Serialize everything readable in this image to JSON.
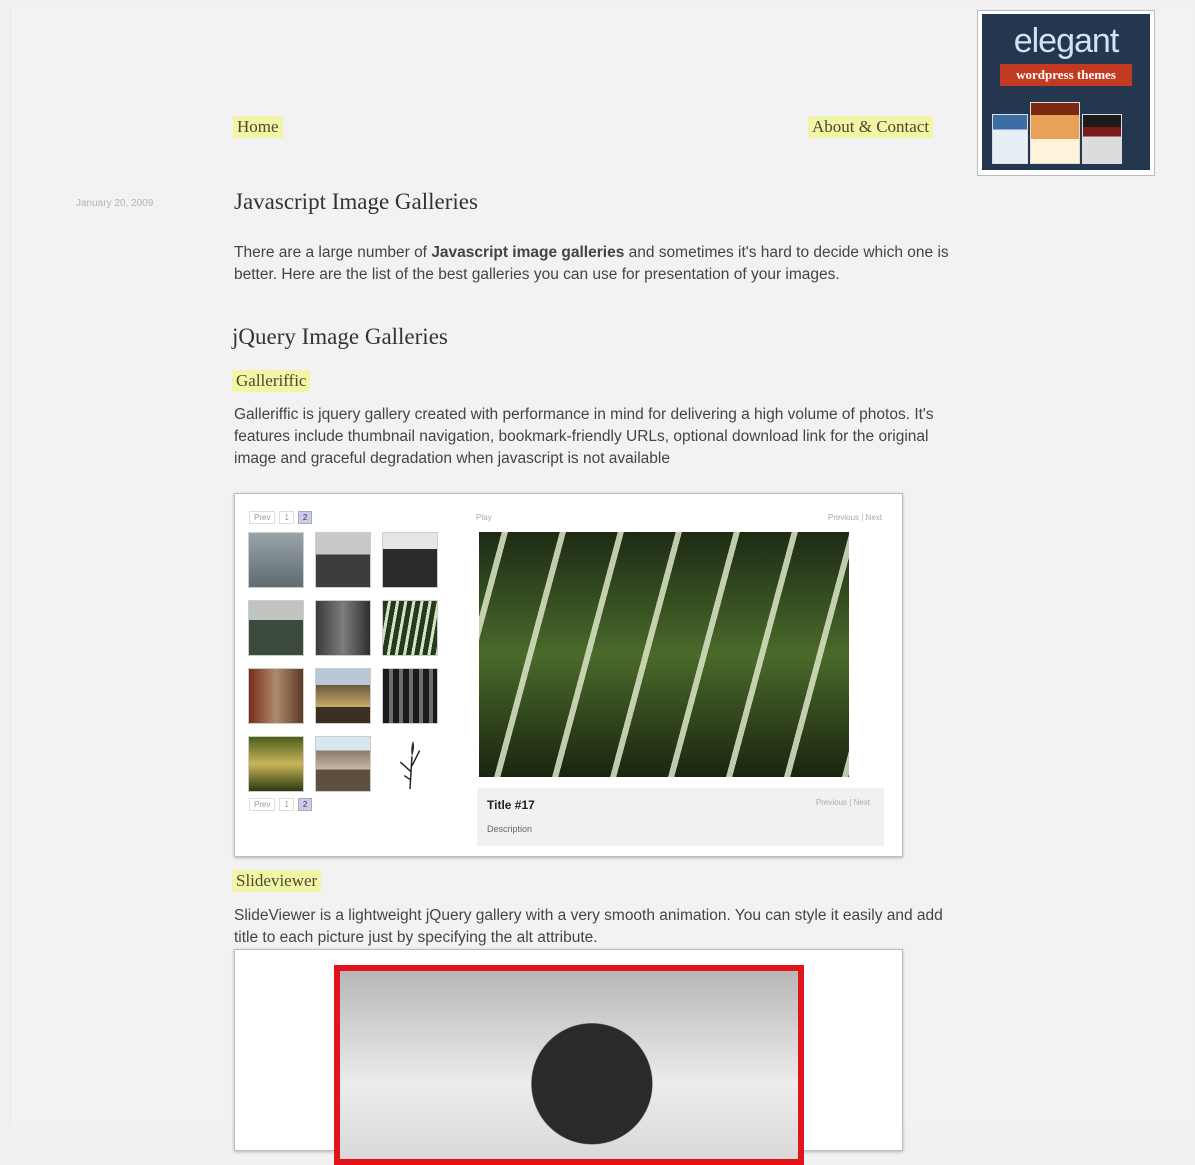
{
  "nav": {
    "home": "Home",
    "about": "About & Contact"
  },
  "ad": {
    "brand": "elegant",
    "tagline": "wordpress themes"
  },
  "post": {
    "date": "January 20, 2009",
    "title": "Javascript Image Galleries",
    "intro_before": "There are a large number of ",
    "intro_bold": "Javascript image galleries",
    "intro_after": " and sometimes it's hard to decide which one is better. Here are the list of the best galleries you can use for presentation of your images."
  },
  "section": {
    "title": "jQuery Image Galleries"
  },
  "galleriffic": {
    "title": "Galleriffic",
    "description": "Galleriffic is jquery gallery created with performance in mind for delivering a high volume of photos. It's features include thumbnail navigation, bookmark-friendly URLs, optional download link for the original image and graceful degradation when javascript is not available",
    "pager": {
      "prev": "Prev",
      "page1": "1",
      "page2": "2"
    },
    "play_label": "Play",
    "nav_label": "Previous | Next",
    "caption_title": "Title #17",
    "caption_desc": "Description",
    "caption_nav": "Previous | Next"
  },
  "slideviewer": {
    "title": "Slideviewer",
    "description": "SlideViewer is a lightweight jQuery gallery with a very smooth animation. You can style it easily and add title to each picture just by specifying the alt attribute."
  }
}
